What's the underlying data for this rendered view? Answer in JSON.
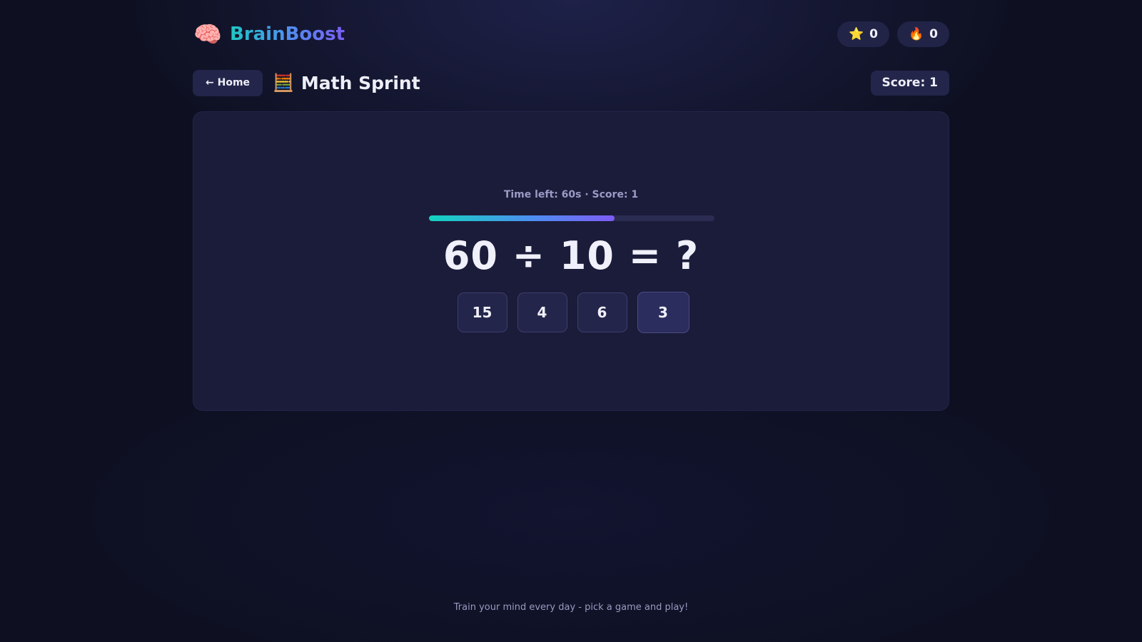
{
  "app": {
    "brand_icon": "brain-icon",
    "brand_emoji": "🧠",
    "brand_name": "BrainBoost",
    "brand_gradient": [
      "#1ec8c4",
      "#4f8ff0",
      "#7c5ff3"
    ]
  },
  "stats": {
    "stars": {
      "icon": "star-icon",
      "emoji": "⭐",
      "value": "0"
    },
    "streak": {
      "icon": "fire-icon",
      "emoji": "🔥",
      "value": "0"
    }
  },
  "game": {
    "home_label": "← Home",
    "icon": "abacus-icon",
    "emoji": "🧮",
    "title": "Math Sprint",
    "score_label": "Score: 1"
  },
  "round": {
    "status": "Time left: 60s · Score: 1",
    "progress": 0.65,
    "question": "60 ÷ 10 = ?",
    "answers": [
      "15",
      "4",
      "6",
      "3"
    ]
  },
  "footer": {
    "text": "Train your mind every day - pick a game and play!"
  }
}
